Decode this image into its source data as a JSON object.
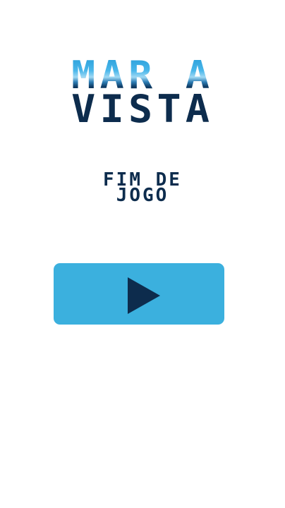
{
  "game": {
    "title_line_1": "MAR À",
    "title_line_2": "VISTA",
    "status_line_1": "FIM DE",
    "status_line_2": "JOGO"
  },
  "play_button": {
    "icon": "play-icon",
    "color": "#3bb0de"
  },
  "colors": {
    "navy": "#0d2c4d",
    "sea_blue": "#3bb0de",
    "background": "#ffffff"
  }
}
